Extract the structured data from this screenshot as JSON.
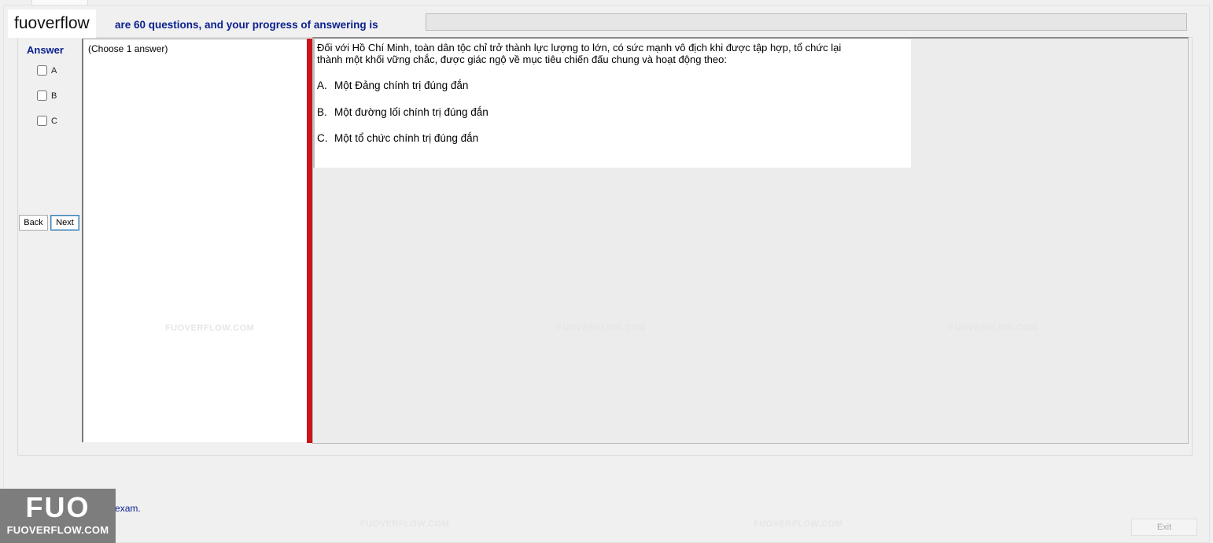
{
  "logo": {
    "text": "fuoverflow"
  },
  "header": {
    "progress_text": "are 60 questions, and your progress of answering is",
    "progress_percent": 0
  },
  "answer_panel": {
    "title": "Answer",
    "options": [
      "A",
      "B",
      "C"
    ]
  },
  "nav": {
    "back_label": "Back",
    "next_label": "Next"
  },
  "choose_hint": "(Choose 1 answer)",
  "question": {
    "text": "Đối với Hồ Chí Minh, toàn dân tộc chỉ trở thành lực lượng to lớn, có sức mạnh vô địch khi được tập hợp, tổ chức lại thành một khối vững chắc, được giác ngộ về mục tiêu chiến đấu chung và hoạt động theo:",
    "options": [
      {
        "letter": "A.",
        "text": "Một Đảng chính trị đúng đắn"
      },
      {
        "letter": "B.",
        "text": "Một đường lối chính trị đúng đắn"
      },
      {
        "letter": "C.",
        "text": "Một tổ chức chính trị đúng đắn"
      }
    ]
  },
  "finish": {
    "label": "I want to finish the exam."
  },
  "exit_label": "Exit",
  "watermark": {
    "text": "FUOVERFLOW.COM"
  },
  "brand_logo": {
    "big": "FUO",
    "small": "FUOVERFLOW.COM"
  },
  "colors": {
    "accent_text": "#0a1f8f",
    "splitter": "#c8161a",
    "progress_fill": "#06b025"
  }
}
